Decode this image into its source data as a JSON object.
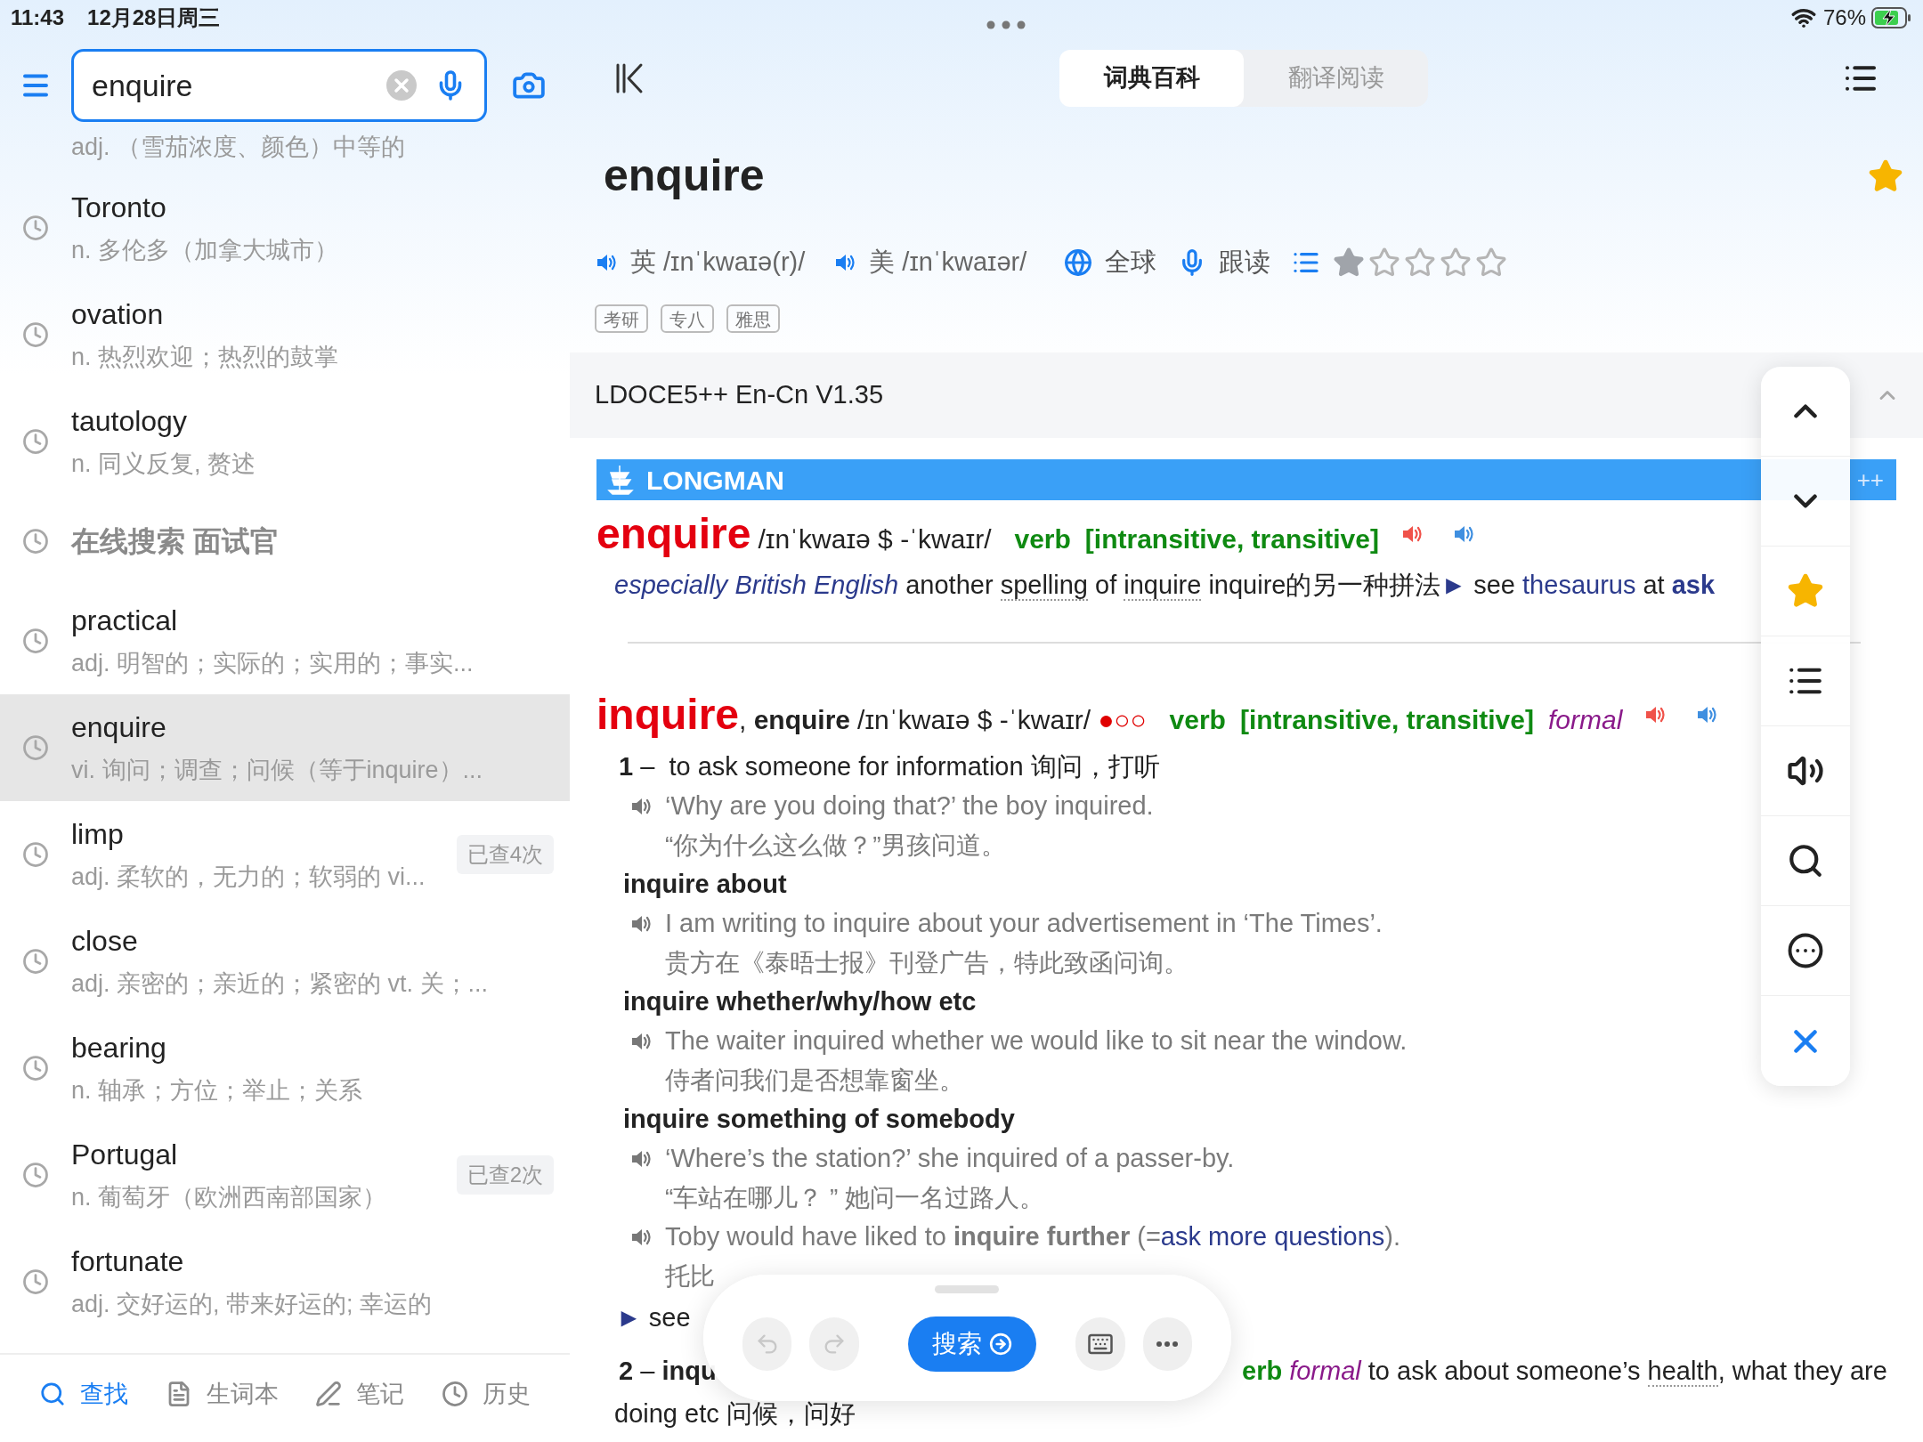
{
  "status_bar": {
    "time": "11:43",
    "date": "12月28日周三",
    "battery": "76%"
  },
  "search": {
    "value": "enquire",
    "suggestion": "adj. （雪茄浓度、颜色）中等的"
  },
  "history": [
    {
      "kind": "word",
      "word": "Toronto",
      "definition": "n. 多伦多（加拿大城市）",
      "selected": false
    },
    {
      "kind": "word",
      "word": "ovation",
      "definition": "n. 热烈欢迎；热烈的鼓掌",
      "selected": false
    },
    {
      "kind": "word",
      "word": "tautology",
      "definition": "n. 同义反复, 赘述",
      "selected": false
    },
    {
      "kind": "online",
      "word": "在线搜索 面试官",
      "selected": false
    },
    {
      "kind": "word",
      "word": "practical",
      "definition": "adj. 明智的；实际的；实用的；事实...",
      "selected": false
    },
    {
      "kind": "word",
      "word": "enquire",
      "definition": "vi. 询问；调查；问候（等于inquire）...",
      "selected": true
    },
    {
      "kind": "word",
      "word": "limp",
      "definition": "adj. 柔软的，无力的；软弱的 vi...",
      "count": "已查4次",
      "selected": false
    },
    {
      "kind": "word",
      "word": "close",
      "definition": "adj. 亲密的；亲近的；紧密的 vt. 关；...",
      "selected": false
    },
    {
      "kind": "word",
      "word": "bearing",
      "definition": "n. 轴承；方位；举止；关系",
      "selected": false
    },
    {
      "kind": "word",
      "word": "Portugal",
      "definition": "n. 葡萄牙（欧洲西南部国家）",
      "count": "已查2次",
      "selected": false
    },
    {
      "kind": "word",
      "word": "fortunate",
      "definition": "adj. 交好运的, 带来好运的; 幸运的",
      "selected": false
    }
  ],
  "bottom_tabs": [
    {
      "kind": "search",
      "label": "查找",
      "selected": true
    },
    {
      "kind": "wordbook",
      "label": "生词本",
      "selected": false
    },
    {
      "kind": "notes",
      "label": "笔记",
      "selected": false
    },
    {
      "kind": "history",
      "label": "历史",
      "selected": false
    }
  ],
  "view_tabs": [
    {
      "label": "词典百科",
      "selected": true
    },
    {
      "label": "翻译阅读",
      "selected": false
    }
  ],
  "entry": {
    "headword": "enquire",
    "starred": true,
    "pronunciations": [
      {
        "region": "英",
        "ipa": "/ɪnˈkwaɪə(r)/"
      },
      {
        "region": "美",
        "ipa": "/ɪnˈkwaɪər/"
      }
    ],
    "actions": [
      {
        "kind": "global",
        "label": "全球"
      },
      {
        "kind": "follow",
        "label": "跟读"
      }
    ],
    "stars": 1,
    "tags": [
      "考研",
      "专八",
      "雅思"
    ]
  },
  "dictionary": {
    "name": "LDOCE5++ En-Cn V1.35",
    "expanded": true,
    "brand": "LONGMAN",
    "brand_suffix": "++",
    "lines": [
      {
        "kind": "headline",
        "audio": true,
        "headword": "enquire",
        "pronunciation": "/ɪnˈkwaɪə $ -ˈkwaɪr/",
        "pos": "verb",
        "grammar": "[intransitive, transitive]"
      },
      {
        "kind": "note",
        "parts": [
          {
            "label": "especially British English"
          },
          {
            "text": " another "
          },
          {
            "cross_ref": "spelling"
          },
          {
            "text": " of "
          },
          {
            "cross_ref": "inquire"
          },
          {
            "text": " inquire的另一种拼法"
          },
          {
            "marker": "►"
          },
          {
            "text": " see "
          },
          {
            "link": "thesaurus"
          },
          {
            "text": " at "
          },
          {
            "link": "**ask**"
          }
        ]
      },
      {
        "kind": "rule"
      },
      {
        "kind": "headline",
        "audio": true,
        "headword": "inquire",
        "variant": ", **enquire**",
        "pronunciation": "/ɪnˈkwaɪə $ -ˈkwaɪr/",
        "frequency": "●○○",
        "pos": "verb",
        "grammar": "[intransitive, transitive]",
        "register": "formal"
      },
      {
        "kind": "sense",
        "parts": [
          {
            "text": "**1** –  to ask someone for information 询问，打听"
          }
        ]
      },
      {
        "kind": "example",
        "audio": true,
        "parts": [
          {
            "text": "‘Why are you doing that?’ the boy inquired."
          }
        ]
      },
      {
        "kind": "translation",
        "parts": [
          {
            "text": "“你为什么这么做？”男孩问道。"
          }
        ]
      },
      {
        "kind": "phrase",
        "parts": [
          {
            "text": "inquire about"
          }
        ]
      },
      {
        "kind": "example",
        "audio": true,
        "parts": [
          {
            "text": "I am writing to inquire about your advertisement in ‘The Times’."
          }
        ]
      },
      {
        "kind": "translation",
        "parts": [
          {
            "text": "贵方在《泰晤士报》刊登广告，特此致函问询。"
          }
        ]
      },
      {
        "kind": "phrase",
        "parts": [
          {
            "text": "inquire whether/why/how etc"
          }
        ]
      },
      {
        "kind": "example",
        "audio": true,
        "parts": [
          {
            "text": "The waiter inquired whether we would like to sit near the window."
          }
        ]
      },
      {
        "kind": "translation",
        "parts": [
          {
            "text": "侍者问我们是否想靠窗坐。"
          }
        ]
      },
      {
        "kind": "phrase",
        "parts": [
          {
            "text": "inquire something of somebody"
          }
        ]
      },
      {
        "kind": "example",
        "audio": true,
        "parts": [
          {
            "text": "‘Where’s the station?’ she inquired of a passer-by."
          }
        ]
      },
      {
        "kind": "translation",
        "parts": [
          {
            "text": "“车站在哪儿？ ” 她问一名过路人。"
          }
        ]
      },
      {
        "kind": "example",
        "audio": true,
        "parts": [
          {
            "text": "Toby would have liked to **inquire further** (="
          },
          {
            "link": "ask more questions"
          },
          {
            "text": ")."
          }
        ]
      },
      {
        "kind": "translation",
        "parts": [
          {
            "text": "托比"
          }
        ]
      },
      {
        "kind": "see",
        "parts": [
          {
            "marker": "►"
          },
          {
            "text": " see"
          }
        ]
      },
      {
        "kind": "split",
        "parts": [
          {
            "text": "**2** – **inqu**"
          }
        ],
        "right": [
          {
            "pos": "erb"
          },
          {
            "register": "formal"
          },
          {
            "text": " to ask about someone’s "
          },
          {
            "cross_ref": "health"
          },
          {
            "text": ", what they are"
          }
        ]
      },
      {
        "kind": "text",
        "parts": [
          {
            "text": "doing etc 问候，问好"
          }
        ]
      }
    ]
  },
  "toolbar": {
    "search_label": "搜索",
    "undo_disabled": true,
    "redo_disabled": true
  }
}
